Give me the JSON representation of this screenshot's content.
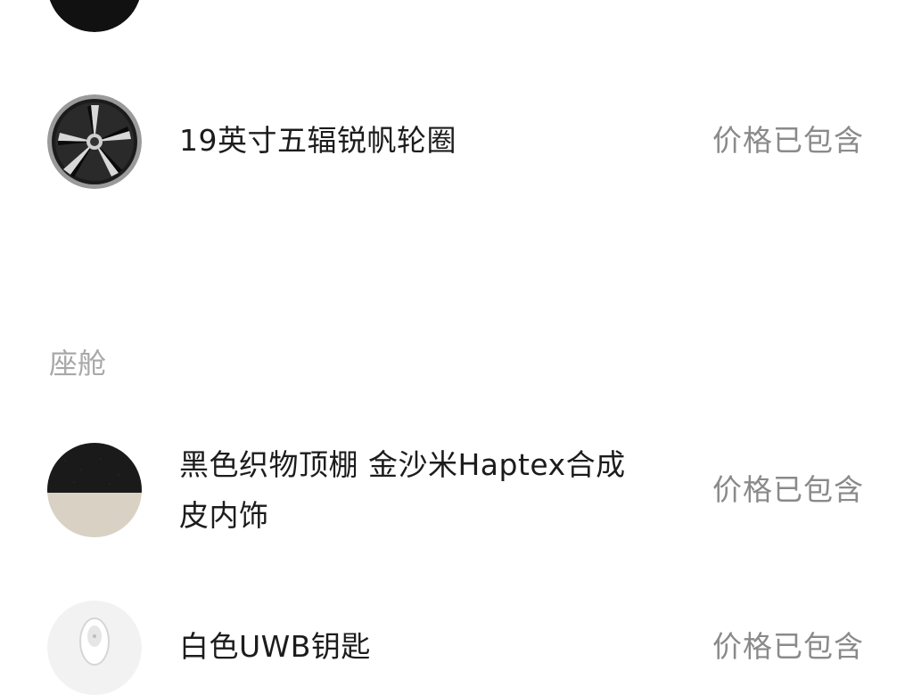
{
  "options": [
    {
      "title": "19英寸五辐锐帆轮圈",
      "price": "价格已包含",
      "icon": "wheel-rim-icon"
    }
  ],
  "cabin": {
    "section_label": "座舱",
    "items": [
      {
        "title_line1": "黑色织物顶棚 金沙米Haptex合成",
        "title_line2": "皮内饰",
        "price": "价格已包含",
        "icon": "interior-swatch-icon"
      },
      {
        "title": "白色UWB钥匙",
        "price": "价格已包含",
        "icon": "uwb-key-icon"
      }
    ]
  },
  "colors": {
    "title_text": "#1c1c1c",
    "price_text": "#8a8a8a",
    "section_label": "#a8a8a8",
    "top_swatch": "#111111",
    "interior_top": "#1a1a1a",
    "interior_bottom": "#d9d2c4"
  }
}
